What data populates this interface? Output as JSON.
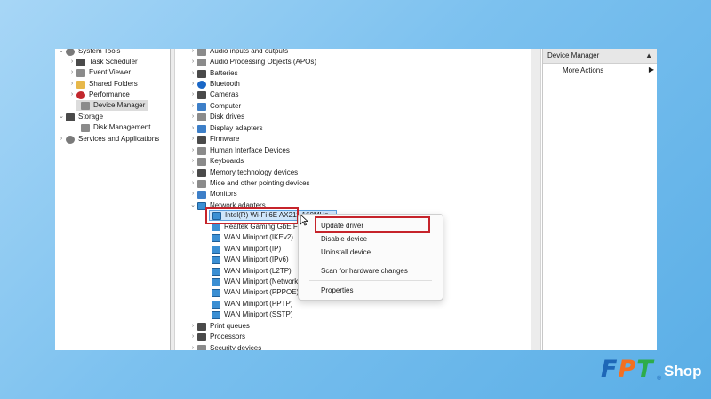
{
  "left_tree": {
    "items": [
      {
        "label": "System Tools",
        "chevron": "⌄",
        "icon": "tools-icon"
      },
      {
        "label": "Task Scheduler",
        "chevron": "›",
        "icon": "clock-icon"
      },
      {
        "label": "Event Viewer",
        "chevron": "›",
        "icon": "event-viewer-icon"
      },
      {
        "label": "Shared Folders",
        "chevron": "›",
        "icon": "folder-icon"
      },
      {
        "label": "Performance",
        "chevron": "›",
        "icon": "performance-icon"
      },
      {
        "label": "Device Manager",
        "chevron": "",
        "icon": "device-manager-icon"
      },
      {
        "label": "Storage",
        "chevron": "⌄",
        "icon": "storage-icon"
      },
      {
        "label": "Disk Management",
        "chevron": "",
        "icon": "disk-icon"
      },
      {
        "label": "Services and Applications",
        "chevron": "›",
        "icon": "services-icon"
      }
    ]
  },
  "device_tree": {
    "categories_top": [
      "Audio inputs and outputs",
      "Audio Processing Objects (APOs)",
      "Batteries",
      "Bluetooth",
      "Cameras",
      "Computer",
      "Disk drives",
      "Display adapters",
      "Firmware",
      "Human Interface Devices",
      "Keyboards",
      "Memory technology devices",
      "Mice and other pointing devices",
      "Monitors",
      "Network adapters"
    ],
    "network_adapters": [
      "Intel(R) Wi-Fi 6E AX211 160MHz",
      "Realtek Gaming GbE Family Controller",
      "WAN Miniport (IKEv2)",
      "WAN Miniport (IP)",
      "WAN Miniport (IPv6)",
      "WAN Miniport (L2TP)",
      "WAN Miniport (Network Monitor)",
      "WAN Miniport (PPPOE)",
      "WAN Miniport (PPTP)",
      "WAN Miniport (SSTP)"
    ],
    "categories_bottom": [
      "Print queues",
      "Processors",
      "Security devices"
    ]
  },
  "context_menu": {
    "update": "Update driver",
    "disable": "Disable device",
    "uninstall": "Uninstall device",
    "scan": "Scan for hardware changes",
    "properties": "Properties"
  },
  "action_pane": {
    "title": "Device Manager",
    "more_actions": "More Actions"
  },
  "logo": {
    "f": "F",
    "p": "P",
    "t": "T",
    "shop": "Shop",
    "reg": "®"
  },
  "colors": {
    "highlight_box": "#c6242b",
    "selection": "#cfe6fb",
    "background": "#7cc1ef"
  }
}
